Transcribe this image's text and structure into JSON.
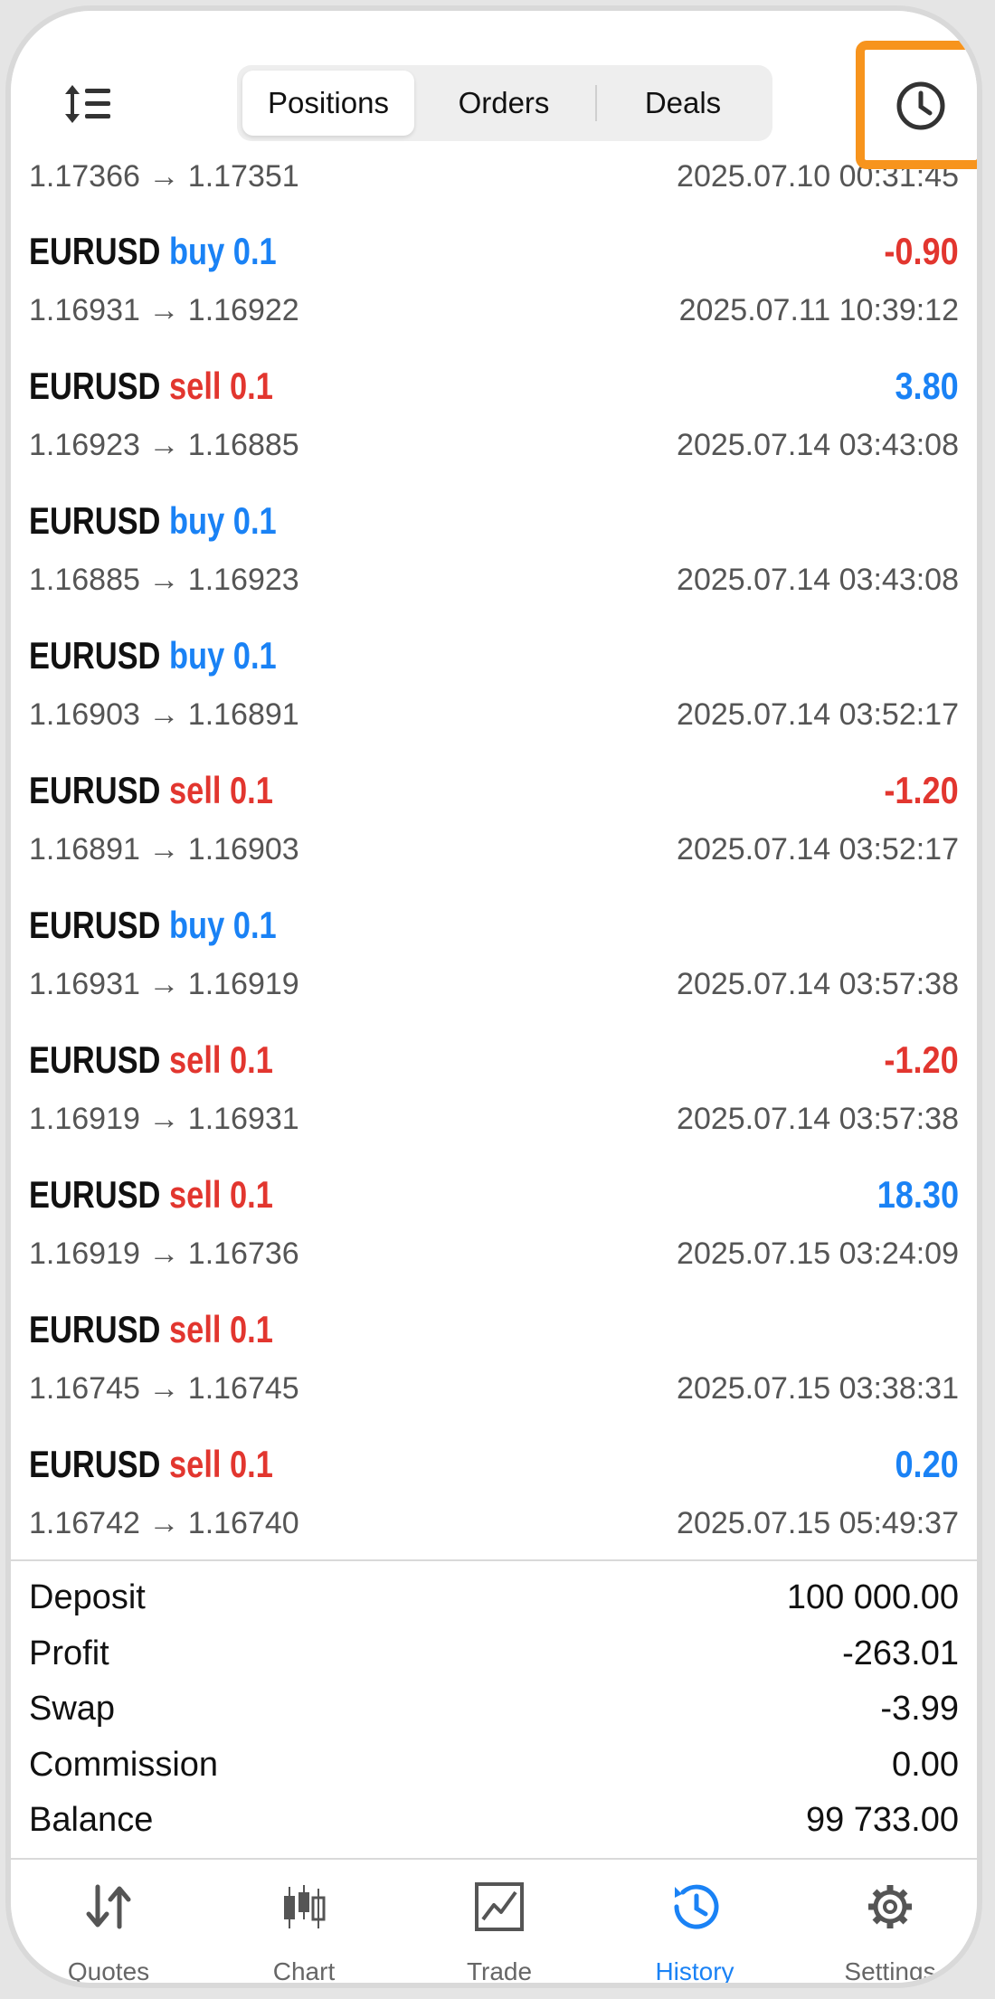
{
  "segments": {
    "positions": "Positions",
    "orders": "Orders",
    "deals": "Deals"
  },
  "partial_row": {
    "prices": "1.17366 → 1.17351",
    "time": "2025.07.10 00:31:45"
  },
  "rows": [
    {
      "symbol": "EURUSD",
      "side": "buy 0.1",
      "profit": "-0.90",
      "prices": "1.16931 → 1.16922",
      "time": "2025.07.11 10:39:12"
    },
    {
      "symbol": "EURUSD",
      "side": "sell 0.1",
      "profit": "3.80",
      "prices": "1.16923 → 1.16885",
      "time": "2025.07.14 03:43:08"
    },
    {
      "symbol": "EURUSD",
      "side": "buy 0.1",
      "profit": "",
      "prices": "1.16885 → 1.16923",
      "time": "2025.07.14 03:43:08"
    },
    {
      "symbol": "EURUSD",
      "side": "buy 0.1",
      "profit": "",
      "prices": "1.16903 → 1.16891",
      "time": "2025.07.14 03:52:17"
    },
    {
      "symbol": "EURUSD",
      "side": "sell 0.1",
      "profit": "-1.20",
      "prices": "1.16891 → 1.16903",
      "time": "2025.07.14 03:52:17"
    },
    {
      "symbol": "EURUSD",
      "side": "buy 0.1",
      "profit": "",
      "prices": "1.16931 → 1.16919",
      "time": "2025.07.14 03:57:38"
    },
    {
      "symbol": "EURUSD",
      "side": "sell 0.1",
      "profit": "-1.20",
      "prices": "1.16919 → 1.16931",
      "time": "2025.07.14 03:57:38"
    },
    {
      "symbol": "EURUSD",
      "side": "sell 0.1",
      "profit": "18.30",
      "prices": "1.16919 → 1.16736",
      "time": "2025.07.15 03:24:09"
    },
    {
      "symbol": "EURUSD",
      "side": "sell 0.1",
      "profit": "",
      "prices": "1.16745 → 1.16745",
      "time": "2025.07.15 03:38:31"
    },
    {
      "symbol": "EURUSD",
      "side": "sell 0.1",
      "profit": "0.20",
      "prices": "1.16742 → 1.16740",
      "time": "2025.07.15 05:49:37"
    }
  ],
  "summary": {
    "deposit_label": "Deposit",
    "deposit": "100 000.00",
    "profit_label": "Profit",
    "profit": "-263.01",
    "swap_label": "Swap",
    "swap": "-3.99",
    "commission_label": "Commission",
    "commission": "0.00",
    "balance_label": "Balance",
    "balance": "99 733.00"
  },
  "tabs": {
    "quotes": "Quotes",
    "chart": "Chart",
    "trade": "Trade",
    "history": "History",
    "settings": "Settings"
  },
  "colors": {
    "buy": "#1a82f5",
    "sell": "#e2362f",
    "highlight": "#f7941d"
  }
}
